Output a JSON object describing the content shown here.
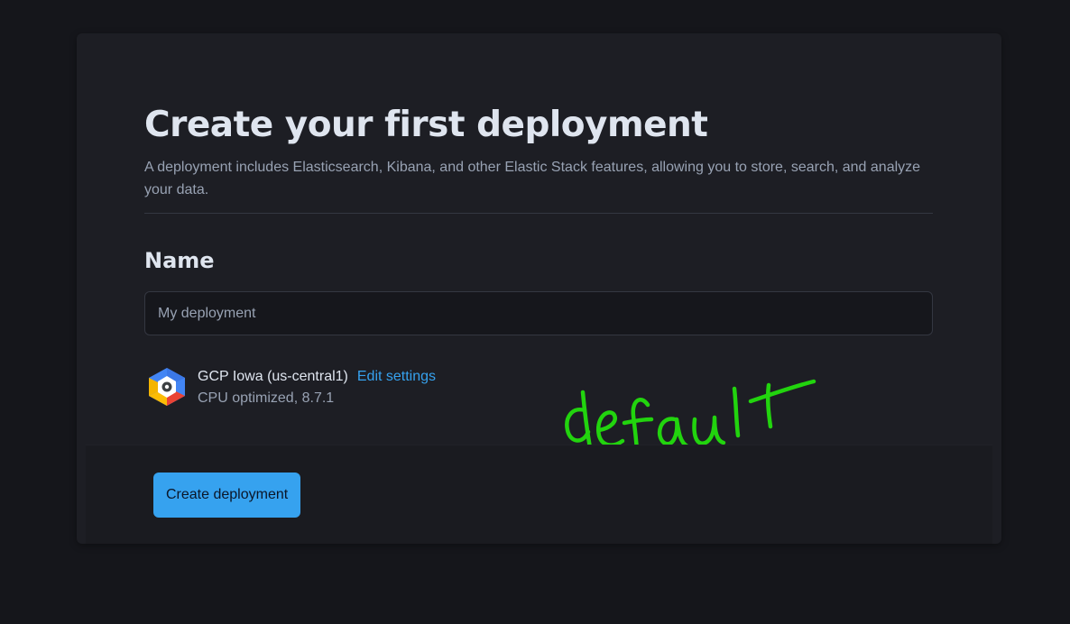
{
  "page": {
    "title": "Create your first deployment",
    "subtitle": "A deployment includes Elasticsearch, Kibana, and other Elastic Stack features, allowing you to store, search, and analyze your data."
  },
  "name_section": {
    "label": "Name",
    "input_value": "",
    "input_placeholder": "My deployment"
  },
  "region": {
    "icon": "gcp-logo-icon",
    "name": "GCP Iowa (us-central1)",
    "edit_label": "Edit settings",
    "details": "CPU optimized, 8.7.1"
  },
  "annotation": {
    "text": "default",
    "color": "#22d40e"
  },
  "footer": {
    "create_button_label": "Create deployment"
  },
  "colors": {
    "background": "#15161b",
    "card": "#1d1e24",
    "accent": "#36a2ef",
    "text_primary": "#dfe5ef",
    "text_secondary": "#98a2b3"
  }
}
